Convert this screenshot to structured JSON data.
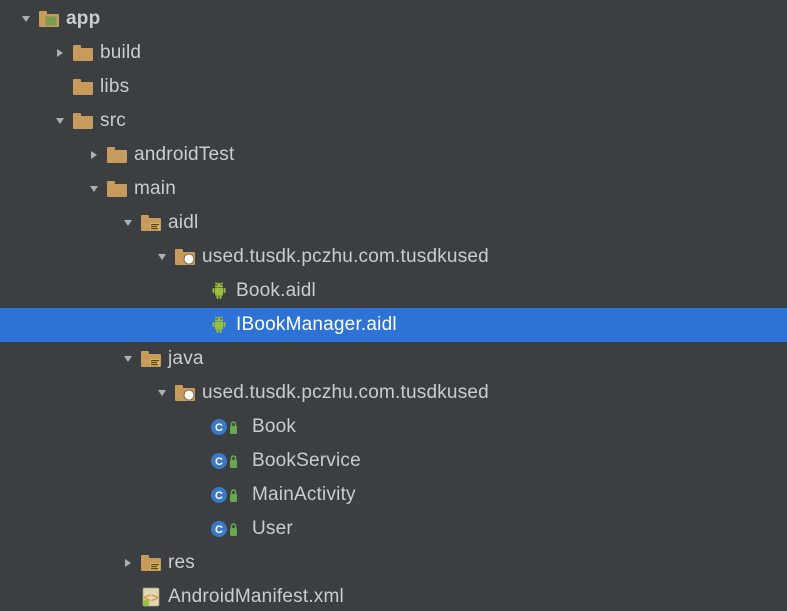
{
  "colors": {
    "bg": "#3b3f41",
    "text": "#c9cdd1",
    "selection": "#2f72d6",
    "folder": "#c89a5b",
    "android_green": "#98c03c",
    "class_blue": "#3b79c6",
    "lock_green": "#6aa84f",
    "module_green": "#6aa84f",
    "xml_orange": "#d99a3b"
  },
  "tree": [
    {
      "id": "app",
      "depth": 0,
      "arrow": "down",
      "icon": "module-icon",
      "label": "app",
      "bold": true
    },
    {
      "id": "build",
      "depth": 1,
      "arrow": "right",
      "icon": "folder-icon",
      "label": "build",
      "bold": false
    },
    {
      "id": "libs",
      "depth": 1,
      "arrow": "none",
      "icon": "folder-icon",
      "label": "libs",
      "bold": false
    },
    {
      "id": "src",
      "depth": 1,
      "arrow": "down",
      "icon": "folder-icon",
      "label": "src",
      "bold": false
    },
    {
      "id": "androidTest",
      "depth": 2,
      "arrow": "right",
      "icon": "folder-icon",
      "label": "androidTest",
      "bold": false
    },
    {
      "id": "main",
      "depth": 2,
      "arrow": "down",
      "icon": "folder-icon",
      "label": "main",
      "bold": false
    },
    {
      "id": "aidl",
      "depth": 3,
      "arrow": "down",
      "icon": "src-folder-icon",
      "label": "aidl",
      "bold": false
    },
    {
      "id": "pkg-aidl",
      "depth": 4,
      "arrow": "down",
      "icon": "package-icon",
      "label": "used.tusdk.pczhu.com.tusdkused",
      "bold": false
    },
    {
      "id": "book-aidl",
      "depth": 5,
      "arrow": "none",
      "icon": "android-icon",
      "label": "Book.aidl",
      "bold": false
    },
    {
      "id": "ibookmgr-aidl",
      "depth": 5,
      "arrow": "none",
      "icon": "android-icon",
      "label": "IBookManager.aidl",
      "bold": false,
      "selected": true
    },
    {
      "id": "java",
      "depth": 3,
      "arrow": "down",
      "icon": "src-folder-icon",
      "label": "java",
      "bold": false
    },
    {
      "id": "pkg-java",
      "depth": 4,
      "arrow": "down",
      "icon": "package-icon",
      "label": "used.tusdk.pczhu.com.tusdkused",
      "bold": false
    },
    {
      "id": "class-book",
      "depth": 5,
      "arrow": "none",
      "icon": "class-icon",
      "label": "Book",
      "bold": false
    },
    {
      "id": "class-bookserv",
      "depth": 5,
      "arrow": "none",
      "icon": "class-icon",
      "label": "BookService",
      "bold": false
    },
    {
      "id": "class-mainact",
      "depth": 5,
      "arrow": "none",
      "icon": "class-icon",
      "label": "MainActivity",
      "bold": false
    },
    {
      "id": "class-user",
      "depth": 5,
      "arrow": "none",
      "icon": "class-icon",
      "label": "User",
      "bold": false
    },
    {
      "id": "res",
      "depth": 3,
      "arrow": "right",
      "icon": "src-folder-icon",
      "label": "res",
      "bold": false
    },
    {
      "id": "manifest",
      "depth": 3,
      "arrow": "none",
      "icon": "manifest-icon",
      "label": "AndroidManifest.xml",
      "bold": false
    }
  ]
}
